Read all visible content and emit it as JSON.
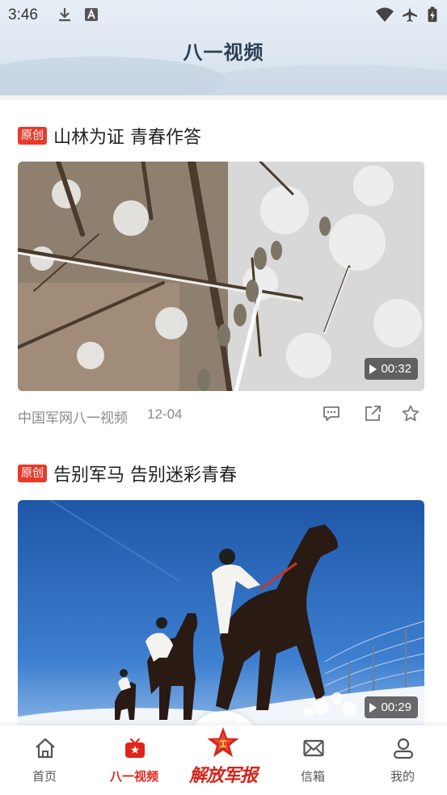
{
  "status_bar": {
    "time": "3:46",
    "icons": [
      "download-icon",
      "font-a-icon",
      "wifi-icon",
      "airplane-icon",
      "battery-charging-icon"
    ]
  },
  "header": {
    "title": "八一视频"
  },
  "cards": [
    {
      "tag": "原创",
      "title": "山林为证 青春作答",
      "duration": "00:32",
      "source": "中国军网八一视频",
      "date": "12-04"
    },
    {
      "tag": "原创",
      "title": "告别军马 告别迷彩青春",
      "duration": "00:29"
    }
  ],
  "card_actions": [
    "comment-icon",
    "share-icon",
    "star-icon"
  ],
  "bottom_nav": {
    "items": [
      {
        "label": "首页",
        "icon": "home-icon",
        "active": false
      },
      {
        "label": "八一视频",
        "icon": "tv-icon",
        "active": true
      },
      {
        "label": "信箱",
        "icon": "mail-icon",
        "active": false
      },
      {
        "label": "我的",
        "icon": "user-icon",
        "active": false
      }
    ],
    "brand": {
      "text": "解放军报",
      "icon": "red-star-emblem-icon"
    }
  },
  "colors": {
    "accent": "#e2231a",
    "tag_bg": "#e83a2b",
    "title_text": "#2d3f53",
    "meta_text": "#8a8a8a"
  }
}
